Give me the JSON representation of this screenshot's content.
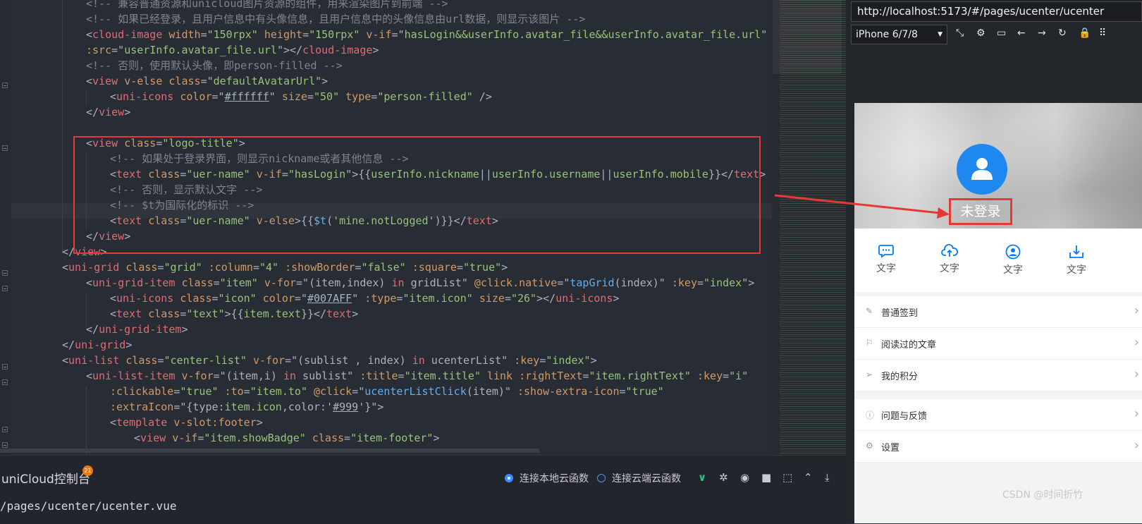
{
  "editor": {
    "lines": [
      [
        [
          "c",
          "<!-- 兼容普通资源和unicloud图片资源的组件，用来渲染图片到前端 -->"
        ]
      ],
      [
        [
          "c",
          "<!-- 如果已经登录，且用户信息中有头像信息，且用户信息中的头像信息由url数据，则显示该图片 -->"
        ]
      ],
      [
        [
          "p",
          "<"
        ],
        [
          "k",
          "cloud-image"
        ],
        [
          "p",
          " "
        ],
        [
          "a",
          "width"
        ],
        [
          "p",
          "="
        ],
        [
          "s",
          "\"150rpx\""
        ],
        [
          "p",
          " "
        ],
        [
          "a",
          "height"
        ],
        [
          "p",
          "="
        ],
        [
          "s",
          "\"150rpx\""
        ],
        [
          "p",
          " "
        ],
        [
          "a",
          "v-if"
        ],
        [
          "p",
          "=\""
        ],
        [
          "s",
          "hasLogin&&userInfo.avatar_file&&userInfo.avatar_file.url"
        ],
        [
          "p",
          "\""
        ]
      ],
      [
        [
          "a",
          ":src"
        ],
        [
          "p",
          "=\""
        ],
        [
          "s",
          "userInfo.avatar_file.url"
        ],
        [
          "p",
          "\"></"
        ],
        [
          "k",
          "cloud-image"
        ],
        [
          "p",
          ">"
        ]
      ],
      [
        [
          "c",
          "<!-- 否则，使用默认头像，即person-filled -->"
        ]
      ],
      [
        [
          "p",
          "<"
        ],
        [
          "k",
          "view"
        ],
        [
          "p",
          " "
        ],
        [
          "a",
          "v-else"
        ],
        [
          "p",
          " "
        ],
        [
          "a",
          "class"
        ],
        [
          "p",
          "="
        ],
        [
          "s",
          "\"defaultAvatarUrl\""
        ],
        [
          "p",
          ">"
        ]
      ],
      [
        [
          "p",
          "<"
        ],
        [
          "k",
          "uni-icons"
        ],
        [
          "p",
          " "
        ],
        [
          "a",
          "color"
        ],
        [
          "p",
          "=\""
        ],
        [
          "ul",
          "#ffffff"
        ],
        [
          "p",
          "\" "
        ],
        [
          "a",
          "size"
        ],
        [
          "p",
          "="
        ],
        [
          "s",
          "\"50\""
        ],
        [
          "p",
          " "
        ],
        [
          "a",
          "type"
        ],
        [
          "p",
          "="
        ],
        [
          "s",
          "\"person-filled\""
        ],
        [
          "p",
          " />"
        ]
      ],
      [
        [
          "p",
          "</"
        ],
        [
          "k",
          "view"
        ],
        [
          "p",
          ">"
        ]
      ],
      [],
      [
        [
          "p",
          "<"
        ],
        [
          "k",
          "view"
        ],
        [
          "p",
          " "
        ],
        [
          "a",
          "class"
        ],
        [
          "p",
          "="
        ],
        [
          "s",
          "\"logo-title\""
        ],
        [
          "p",
          ">"
        ]
      ],
      [
        [
          "c",
          "<!-- 如果处于登录界面，则显示nickname或者其他信息 -->"
        ]
      ],
      [
        [
          "p",
          "<"
        ],
        [
          "k",
          "text"
        ],
        [
          "p",
          " "
        ],
        [
          "a",
          "class"
        ],
        [
          "p",
          "="
        ],
        [
          "s",
          "\"uer-name\""
        ],
        [
          "p",
          " "
        ],
        [
          "a",
          "v-if"
        ],
        [
          "p",
          "="
        ],
        [
          "s",
          "\"hasLogin\""
        ],
        [
          "p",
          ">{{"
        ],
        [
          "s",
          "userInfo.nickname"
        ],
        [
          "p",
          "||"
        ],
        [
          "s",
          "userInfo.username"
        ],
        [
          "p",
          "||"
        ],
        [
          "s",
          "userInfo.mobile"
        ],
        [
          "p",
          "}}</"
        ],
        [
          "k",
          "text"
        ],
        [
          "p",
          ">"
        ]
      ],
      [
        [
          "c",
          "<!-- 否则，显示默认文字 -->"
        ]
      ],
      [
        [
          "c",
          "<!-- $t为国际化的标识 -->"
        ]
      ],
      [
        [
          "p",
          "<"
        ],
        [
          "k",
          "text"
        ],
        [
          "p",
          " "
        ],
        [
          "a",
          "class"
        ],
        [
          "p",
          "="
        ],
        [
          "s",
          "\"uer-name\""
        ],
        [
          "p",
          " "
        ],
        [
          "a",
          "v-else"
        ],
        [
          "p",
          ">{{"
        ],
        [
          "f",
          "$t"
        ],
        [
          "p",
          "("
        ],
        [
          "s",
          "'mine.notLogged'"
        ],
        [
          "p",
          ")}}</"
        ],
        [
          "k",
          "text"
        ],
        [
          "p",
          ">"
        ]
      ],
      [
        [
          "p",
          "</"
        ],
        [
          "k",
          "view"
        ],
        [
          "p",
          ">"
        ]
      ],
      [
        [
          "p",
          "</"
        ],
        [
          "k",
          "view"
        ],
        [
          "p",
          ">"
        ]
      ],
      [
        [
          "p",
          "<"
        ],
        [
          "k",
          "uni-grid"
        ],
        [
          "p",
          " "
        ],
        [
          "a",
          "class"
        ],
        [
          "p",
          "="
        ],
        [
          "s",
          "\"grid\""
        ],
        [
          "p",
          " "
        ],
        [
          "a",
          ":column"
        ],
        [
          "p",
          "="
        ],
        [
          "s",
          "\"4\""
        ],
        [
          "p",
          " "
        ],
        [
          "a",
          ":showBorder"
        ],
        [
          "p",
          "="
        ],
        [
          "s",
          "\"false\""
        ],
        [
          "p",
          " "
        ],
        [
          "a",
          ":square"
        ],
        [
          "p",
          "="
        ],
        [
          "s",
          "\"true\""
        ],
        [
          "p",
          ">"
        ]
      ],
      [
        [
          "p",
          "<"
        ],
        [
          "k",
          "uni-grid-item"
        ],
        [
          "p",
          " "
        ],
        [
          "a",
          "class"
        ],
        [
          "p",
          "="
        ],
        [
          "s",
          "\"item\""
        ],
        [
          "p",
          " "
        ],
        [
          "a",
          "v-for"
        ],
        [
          "p",
          "=\"(item,index) "
        ],
        [
          "k",
          "in"
        ],
        [
          "p",
          " gridList\" "
        ],
        [
          "a",
          "@click.native"
        ],
        [
          "p",
          "=\""
        ],
        [
          "f",
          "tapGrid"
        ],
        [
          "p",
          "(index)\" "
        ],
        [
          "a",
          ":key"
        ],
        [
          "p",
          "="
        ],
        [
          "s",
          "\"index\""
        ],
        [
          "p",
          ">"
        ]
      ],
      [
        [
          "p",
          "<"
        ],
        [
          "k",
          "uni-icons"
        ],
        [
          "p",
          " "
        ],
        [
          "a",
          "class"
        ],
        [
          "p",
          "="
        ],
        [
          "s",
          "\"icon\""
        ],
        [
          "p",
          " "
        ],
        [
          "a",
          "color"
        ],
        [
          "p",
          "=\""
        ],
        [
          "ul",
          "#007AFF"
        ],
        [
          "p",
          "\" "
        ],
        [
          "a",
          ":type"
        ],
        [
          "p",
          "="
        ],
        [
          "s",
          "\"item.icon\""
        ],
        [
          "p",
          " "
        ],
        [
          "a",
          "size"
        ],
        [
          "p",
          "="
        ],
        [
          "s",
          "\"26\""
        ],
        [
          "p",
          "></"
        ],
        [
          "k",
          "uni-icons"
        ],
        [
          "p",
          ">"
        ]
      ],
      [
        [
          "p",
          "<"
        ],
        [
          "k",
          "text"
        ],
        [
          "p",
          " "
        ],
        [
          "a",
          "class"
        ],
        [
          "p",
          "="
        ],
        [
          "s",
          "\"text\""
        ],
        [
          "p",
          ">{{"
        ],
        [
          "s",
          "item.text"
        ],
        [
          "p",
          "}}</"
        ],
        [
          "k",
          "text"
        ],
        [
          "p",
          ">"
        ]
      ],
      [
        [
          "p",
          "</"
        ],
        [
          "k",
          "uni-grid-item"
        ],
        [
          "p",
          ">"
        ]
      ],
      [
        [
          "p",
          "</"
        ],
        [
          "k",
          "uni-grid"
        ],
        [
          "p",
          ">"
        ]
      ],
      [
        [
          "p",
          "<"
        ],
        [
          "k",
          "uni-list"
        ],
        [
          "p",
          " "
        ],
        [
          "a",
          "class"
        ],
        [
          "p",
          "="
        ],
        [
          "s",
          "\"center-list\""
        ],
        [
          "p",
          " "
        ],
        [
          "a",
          "v-for"
        ],
        [
          "p",
          "=\"(sublist , index) "
        ],
        [
          "k",
          "in"
        ],
        [
          "p",
          " ucenterList\" "
        ],
        [
          "a",
          ":key"
        ],
        [
          "p",
          "="
        ],
        [
          "s",
          "\"index\""
        ],
        [
          "p",
          ">"
        ]
      ],
      [
        [
          "p",
          "<"
        ],
        [
          "k",
          "uni-list-item"
        ],
        [
          "p",
          " "
        ],
        [
          "a",
          "v-for"
        ],
        [
          "p",
          "=\"(item,i) "
        ],
        [
          "k",
          "in"
        ],
        [
          "p",
          " sublist\" "
        ],
        [
          "a",
          ":title"
        ],
        [
          "p",
          "="
        ],
        [
          "s",
          "\"item.title\""
        ],
        [
          "p",
          " "
        ],
        [
          "a",
          "link"
        ],
        [
          "p",
          " "
        ],
        [
          "a",
          ":rightText"
        ],
        [
          "p",
          "="
        ],
        [
          "s",
          "\"item.rightText\""
        ],
        [
          "p",
          " "
        ],
        [
          "a",
          ":key"
        ],
        [
          "p",
          "="
        ],
        [
          "s",
          "\"i\""
        ]
      ],
      [
        [
          "a",
          ":clickable"
        ],
        [
          "p",
          "="
        ],
        [
          "s",
          "\"true\""
        ],
        [
          "p",
          " "
        ],
        [
          "a",
          ":to"
        ],
        [
          "p",
          "="
        ],
        [
          "s",
          "\"item.to\""
        ],
        [
          "p",
          " "
        ],
        [
          "a",
          "@click"
        ],
        [
          "p",
          "=\""
        ],
        [
          "f",
          "ucenterListClick"
        ],
        [
          "p",
          "(item)\" "
        ],
        [
          "a",
          ":show-extra-icon"
        ],
        [
          "p",
          "="
        ],
        [
          "s",
          "\"true\""
        ]
      ],
      [
        [
          "a",
          ":extraIcon"
        ],
        [
          "p",
          "=\"{type:"
        ],
        [
          "s",
          "item.icon"
        ],
        [
          "p",
          ",color:'"
        ],
        [
          "ul",
          "#999"
        ],
        [
          "p",
          "'}\">"
        ]
      ],
      [
        [
          "p",
          "<"
        ],
        [
          "k",
          "template"
        ],
        [
          "p",
          " "
        ],
        [
          "a",
          "v-slot:footer"
        ],
        [
          "p",
          ">"
        ]
      ],
      [
        [
          "p",
          "<"
        ],
        [
          "k",
          "view"
        ],
        [
          "p",
          " "
        ],
        [
          "a",
          "v-if"
        ],
        [
          "p",
          "="
        ],
        [
          "s",
          "\"item.showBadge\""
        ],
        [
          "p",
          " "
        ],
        [
          "a",
          "class"
        ],
        [
          "p",
          "="
        ],
        [
          "s",
          "\"item-footer\""
        ],
        [
          "p",
          ">"
        ]
      ]
    ]
  },
  "console": {
    "title": "uniCloud控制台",
    "badge": "21",
    "local_label": "连接本地云函数",
    "cloud_label": "连接云端云函数",
    "path_text": "/pages/ucenter/ucenter.vue"
  },
  "browser": {
    "url": "http://localhost:5173/#/pages/ucenter/ucenter",
    "device": "iPhone 6/7/8",
    "toolbar_icons": [
      "rotate-icon",
      "settings-icon",
      "console-icon",
      "back-icon",
      "forward-icon",
      "refresh-icon",
      "lock-icon",
      "more-icon"
    ]
  },
  "phone": {
    "not_logged": "未登录",
    "grid": [
      {
        "icon": "chat-icon",
        "text": "文字"
      },
      {
        "icon": "cloud-upload-icon",
        "text": "文字"
      },
      {
        "icon": "person-icon",
        "text": "文字"
      },
      {
        "icon": "download-icon",
        "text": "文字"
      }
    ],
    "list1": [
      {
        "icon": "edit-icon",
        "title": "普通签到"
      },
      {
        "icon": "flag-icon",
        "title": "阅读过的文章"
      },
      {
        "icon": "send-icon",
        "title": "我的积分"
      }
    ],
    "list2": [
      {
        "icon": "help-icon",
        "title": "问题与反馈"
      },
      {
        "icon": "gear-icon",
        "title": "设置"
      }
    ]
  },
  "watermark": "CSDN @时间折竹",
  "colors": {
    "accent": "#1e88f0",
    "highlight": "#e53935"
  }
}
